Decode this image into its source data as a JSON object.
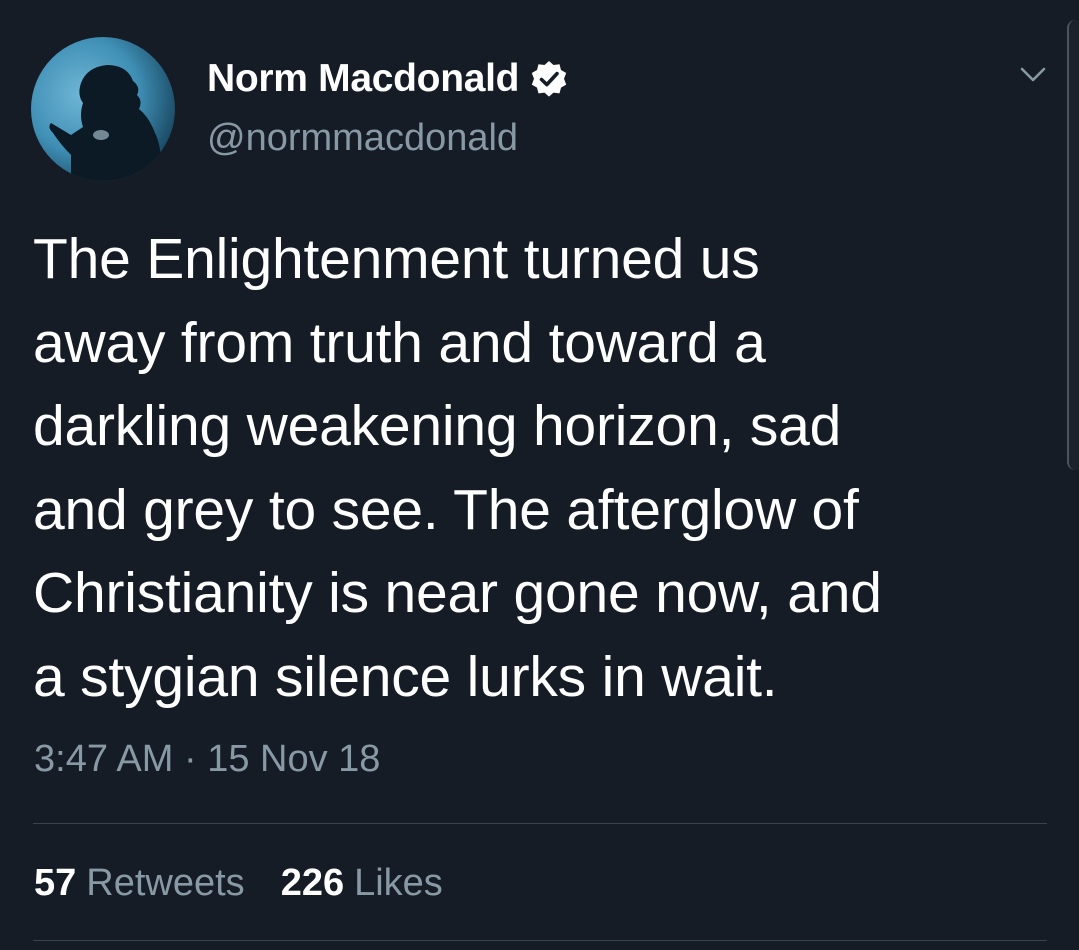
{
  "user": {
    "display_name": "Norm Macdonald",
    "handle": "@normmacdonald",
    "verified": true,
    "verified_color": "#ffffff"
  },
  "tweet": {
    "text": "The Enlightenment turned us\naway from truth and toward a\ndarkling weakening horizon, sad\nand grey to see. The afterglow of\nChristianity is near gone now, and\na stygian silence lurks in wait.",
    "timestamp": "3:47 AM · 15 Nov 18"
  },
  "stats": {
    "retweets_count": "57",
    "retweets_label": "Retweets",
    "likes_count": "226",
    "likes_label": "Likes"
  },
  "icons": {
    "verified": "verified-badge-icon",
    "menu": "chevron-down-icon"
  },
  "colors": {
    "background": "#151c25",
    "primary_text": "#ffffff",
    "secondary_text": "#8899a6",
    "divider": "#38444d"
  }
}
